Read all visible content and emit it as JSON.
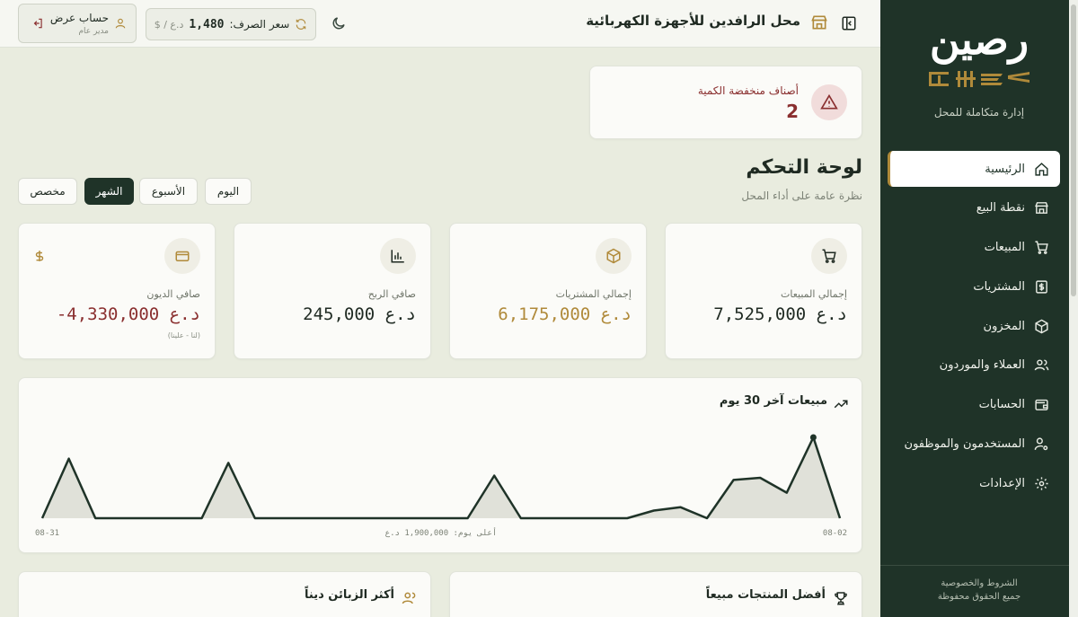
{
  "brand": {
    "logo_text": "رصين",
    "tagline": "إدارة متكاملة للمحل"
  },
  "sidebar": {
    "items": [
      {
        "label": "الرئيسية",
        "icon": "home-icon",
        "active": true
      },
      {
        "label": "نقطة البيع",
        "icon": "store-icon",
        "active": false
      },
      {
        "label": "المبيعات",
        "icon": "cart-icon",
        "active": false
      },
      {
        "label": "المشتريات",
        "icon": "dollar-receipt-icon",
        "active": false
      },
      {
        "label": "المخزون",
        "icon": "box-icon",
        "active": false
      },
      {
        "label": "العملاء والموردون",
        "icon": "users-icon",
        "active": false
      },
      {
        "label": "الحسابات",
        "icon": "wallet-icon",
        "active": false
      },
      {
        "label": "المستخدمون والموظفون",
        "icon": "user-cog-icon",
        "active": false
      },
      {
        "label": "الإعدادات",
        "icon": "gear-icon",
        "active": false
      }
    ],
    "footer_terms": "الشروط والخصوصية",
    "footer_rights": "جميع الحقوق محفوظة"
  },
  "topbar": {
    "shop_title": "محل الرافدين للأجهزة الكهربائية",
    "rate_label": "سعر الصرف:",
    "rate_value": "1,480",
    "rate_unit": "د.ع / $",
    "account_name": "حساب عرض",
    "account_role": "مدير عام"
  },
  "alert": {
    "label": "أصناف منخفضة الكمية",
    "value": "2"
  },
  "page": {
    "title": "لوحة التحكم",
    "subtitle": "نظرة عامة على أداء المحل"
  },
  "filters": {
    "today": "اليوم",
    "week": "الأسبوع",
    "month": "الشهر",
    "custom": "مخصص",
    "active": "month"
  },
  "stats": {
    "sales": {
      "label": "إجمالي المبيعات",
      "value": "7,525,000 د.ع"
    },
    "purchases": {
      "label": "إجمالي المشتريات",
      "value": "6,175,000 د.ع"
    },
    "profit": {
      "label": "صافي الربح",
      "value": "245,000 د.ع"
    },
    "debts": {
      "label": "صافي الديون",
      "value": "-4,330,000 د.ع",
      "note": "(لنا - علينا)"
    }
  },
  "chart_data": {
    "type": "area",
    "title": "مبيعات آخر 30 يوم",
    "x_start_label": "08-31",
    "x_end_label": "08-02",
    "peak_label": "أعلى يوم: 1,900,000 د.ع",
    "peak": 1900000,
    "values": [
      0,
      1400000,
      0,
      0,
      0,
      0,
      0,
      1300000,
      0,
      0,
      0,
      0,
      0,
      0,
      0,
      0,
      0,
      1000000,
      0,
      0,
      0,
      0,
      0,
      180000,
      260000,
      0,
      900000,
      950000,
      600000,
      1900000,
      0
    ]
  },
  "bottom": {
    "top_products": "أفضل المنتجات مبيعاً",
    "top_debtors": "أكثر الزبائن ديناً"
  },
  "colors": {
    "sidebar_bg": "#1f3328",
    "accent_gold": "#b08a3a",
    "danger": "#8a2f2f",
    "page_bg": "#e9ecdf"
  }
}
